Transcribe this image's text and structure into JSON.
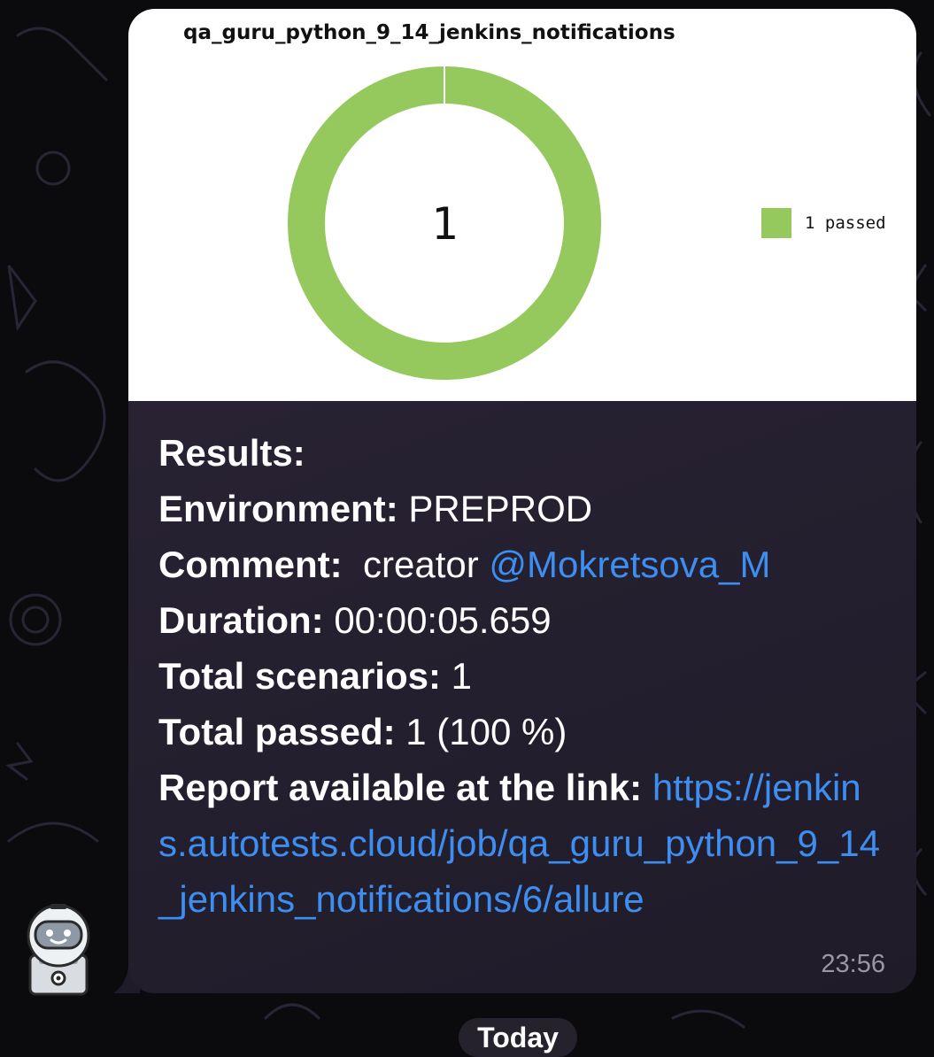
{
  "chart_data": {
    "type": "pie",
    "donut": true,
    "title": "qa_guru_python_9_14_jenkins_notifications",
    "center_label": "1",
    "slices": [
      {
        "label": "1 passed",
        "value": 1,
        "color": "#95c95d"
      }
    ],
    "legend_position": "right"
  },
  "message": {
    "heading": "Results:",
    "environment_label": "Environment:",
    "environment_value": "PREPROD",
    "comment_label": "Comment:",
    "comment_value": "creator",
    "comment_mention": "@Mokretsova_M",
    "duration_label": "Duration:",
    "duration_value": "00:00:05.659",
    "scenarios_label": "Total scenarios:",
    "scenarios_value": "1",
    "passed_label": "Total passed:",
    "passed_value": "1 (100 %)",
    "report_label": "Report available at the link:",
    "report_url": "https://jenkins.autotests.cloud/job/qa_guru_python_9_14_jenkins_notifications/6/allure",
    "time": "23:56"
  },
  "date_pill": "Today",
  "colors": {
    "link": "#3d8ef0",
    "passed": "#95c95d",
    "bubble": "#2a2436"
  },
  "icons": {
    "avatar": "robot-icon"
  }
}
